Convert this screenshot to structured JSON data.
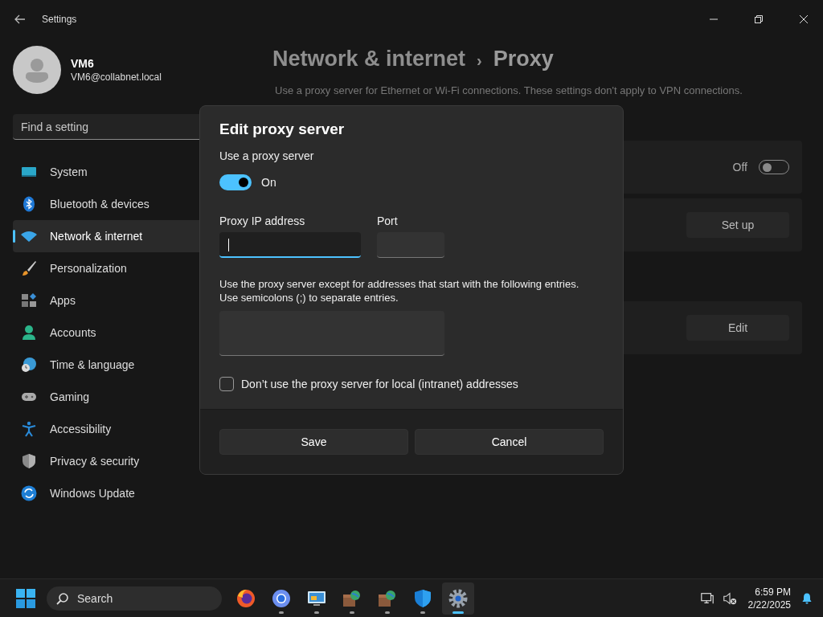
{
  "window": {
    "title": "Settings"
  },
  "user": {
    "name": "VM6",
    "email": "VM6@collabnet.local"
  },
  "search": {
    "placeholder": "Find a setting"
  },
  "nav": [
    {
      "label": "System",
      "kind": "system",
      "selected": false
    },
    {
      "label": "Bluetooth & devices",
      "kind": "bluetooth",
      "selected": false
    },
    {
      "label": "Network & internet",
      "kind": "network",
      "selected": true
    },
    {
      "label": "Personalization",
      "kind": "brush",
      "selected": false
    },
    {
      "label": "Apps",
      "kind": "apps",
      "selected": false
    },
    {
      "label": "Accounts",
      "kind": "accounts",
      "selected": false
    },
    {
      "label": "Time & language",
      "kind": "time",
      "selected": false
    },
    {
      "label": "Gaming",
      "kind": "gaming",
      "selected": false
    },
    {
      "label": "Accessibility",
      "kind": "accessibility",
      "selected": false
    },
    {
      "label": "Privacy & security",
      "kind": "shield",
      "selected": false
    },
    {
      "label": "Windows Update",
      "kind": "update",
      "selected": false
    }
  ],
  "breadcrumb": {
    "parent": "Network & internet",
    "separator": "›",
    "current": "Proxy"
  },
  "description": "Use a proxy server for Ethernet or Wi-Fi connections. These settings don't apply to VPN connections.",
  "cards": [
    {
      "kind": "toggle",
      "state_label": "Off",
      "on": false
    },
    {
      "kind": "button",
      "button": "Set up"
    },
    {
      "kind": "button",
      "button": "Edit"
    }
  ],
  "dialog": {
    "title": "Edit proxy server",
    "toggle_label": "Use a proxy server",
    "toggle": {
      "on": true,
      "state_label": "On"
    },
    "ip_label": "Proxy IP address",
    "ip_focused": true,
    "port_label": "Port",
    "exceptions_help": "Use the proxy server except for addresses that start with the following entries. Use semicolons (;) to separate entries.",
    "local_checkbox": {
      "label": "Don’t use the proxy server for local (intranet) addresses",
      "checked": false
    },
    "buttons": [
      "Save",
      "Cancel"
    ]
  },
  "taskbar": {
    "search_placeholder": "Search",
    "apps": [
      {
        "kind": "firefox",
        "running": false,
        "active": false
      },
      {
        "kind": "chrome",
        "running": true,
        "active": false
      },
      {
        "kind": "remote",
        "running": true,
        "active": false
      },
      {
        "kind": "globe",
        "running": true,
        "active": false
      },
      {
        "kind": "globe",
        "running": true,
        "active": false
      },
      {
        "kind": "shield",
        "running": true,
        "active": false
      },
      {
        "kind": "gear",
        "running": true,
        "active": true
      }
    ],
    "time": "6:59 PM",
    "date": "2/22/2025"
  }
}
